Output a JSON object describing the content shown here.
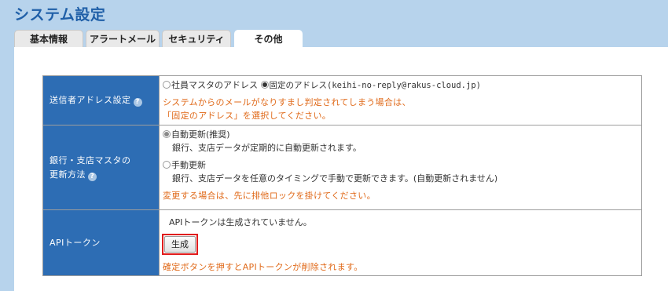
{
  "page": {
    "title": "システム設定"
  },
  "tabs": [
    {
      "label": "基本情報"
    },
    {
      "label": "アラートメール"
    },
    {
      "label": "セキュリティ"
    },
    {
      "label": "その他"
    }
  ],
  "settings": {
    "sender": {
      "label": "送信者アドレス設定",
      "option_master": "社員マスタのアドレス",
      "option_fixed": "固定のアドレス(keihi-no-reply@rakus-cloud.jp)",
      "warning_line1": "システムからのメールがなりすまし判定されてしまう場合は、",
      "warning_line2": "「固定のアドレス」を選択してください。"
    },
    "bank": {
      "label_line1": "銀行・支店マスタの",
      "label_line2": "更新方法",
      "auto_label": "自動更新(推奨)",
      "auto_desc": "銀行、支店データが定期的に自動更新されます。",
      "manual_label": "手動更新",
      "manual_desc": "銀行、支店データを任意のタイミングで手動で更新できます。(自動更新されません)",
      "warning": "変更する場合は、先に排他ロックを掛けてください。"
    },
    "api": {
      "label": "APIトークン",
      "status": "APIトークンは生成されていません。",
      "generate_button": "生成",
      "warning": "確定ボタンを押すとAPIトークンが削除されます。"
    }
  },
  "colors": {
    "background": "#b7d3ec",
    "title": "#1f5fa8",
    "label_cell": "#2d6db4",
    "warning_text": "#e06a1a",
    "highlight_border": "#e01b1b"
  }
}
